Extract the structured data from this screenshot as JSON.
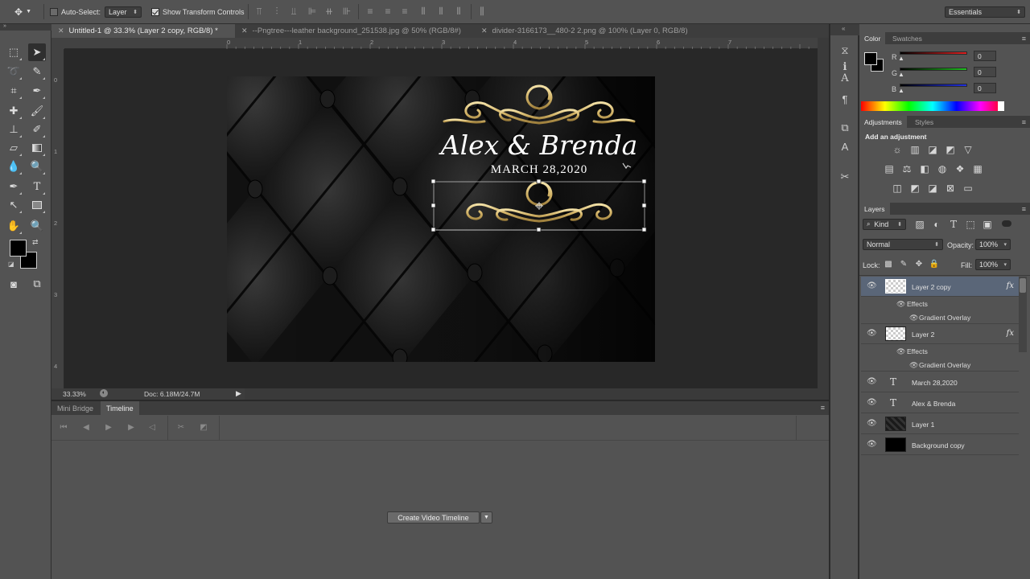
{
  "options_bar": {
    "auto_select_label": "Auto-Select:",
    "auto_select_value": "Layer",
    "show_transform_label": "Show Transform Controls",
    "workspace": "Essentials"
  },
  "doc_tabs": [
    {
      "title": "Untitled-1 @ 33.3% (Layer 2 copy, RGB/8) *",
      "active": true
    },
    {
      "title": "--Pngtree---leather background_251538.jpg @ 50% (RGB/8#)",
      "active": false
    },
    {
      "title": "divider-3166173__480-2 2.png @ 100% (Layer 0, RGB/8)",
      "active": false
    }
  ],
  "ruler": {
    "top_marks": [
      "0",
      "1",
      "2",
      "3",
      "4",
      "5",
      "6",
      "7",
      "8",
      "9"
    ],
    "left_marks": [
      "0",
      "1",
      "2",
      "3",
      "4"
    ]
  },
  "canvas": {
    "names": "Alex & Brenda",
    "date": "MARCH 28,2020",
    "gold": "#d9c07a",
    "gold_dark": "#a88b45"
  },
  "status": {
    "zoom": "33.33%",
    "doc": "Doc: 6.18M/24.7M"
  },
  "bottom_panel": {
    "tabs": [
      "Mini Bridge",
      "Timeline"
    ],
    "create_button": "Create Video Timeline"
  },
  "color_panel": {
    "tabs": [
      "Color",
      "Swatches"
    ],
    "channels": [
      {
        "label": "R",
        "value": "0",
        "color": "#e02020"
      },
      {
        "label": "G",
        "value": "0",
        "color": "#20c020"
      },
      {
        "label": "B",
        "value": "0",
        "color": "#2030e0"
      }
    ]
  },
  "adjustments_panel": {
    "tabs": [
      "Adjustments",
      "Styles"
    ],
    "heading": "Add an adjustment"
  },
  "layers_panel": {
    "title": "Layers",
    "kind_filter": "Kind",
    "blend_mode": "Normal",
    "opacity_label": "Opacity:",
    "opacity_value": "100%",
    "lock_label": "Lock:",
    "fill_label": "Fill:",
    "fill_value": "100%",
    "effects_label": "Effects",
    "gradient_overlay_label": "Gradient Overlay",
    "layers": [
      {
        "name": "Layer 2 copy",
        "kind": "pixel",
        "fx": true,
        "selected": true
      },
      {
        "name": "Layer 2",
        "kind": "pixel",
        "fx": true,
        "selected": false
      },
      {
        "name": "March 28,2020",
        "kind": "text",
        "fx": false,
        "selected": false
      },
      {
        "name": "Alex & Brenda",
        "kind": "text",
        "fx": false,
        "selected": false
      },
      {
        "name": "Layer 1",
        "kind": "leather",
        "fx": false,
        "selected": false
      },
      {
        "name": "Background copy",
        "kind": "black",
        "fx": false,
        "selected": false
      }
    ]
  }
}
